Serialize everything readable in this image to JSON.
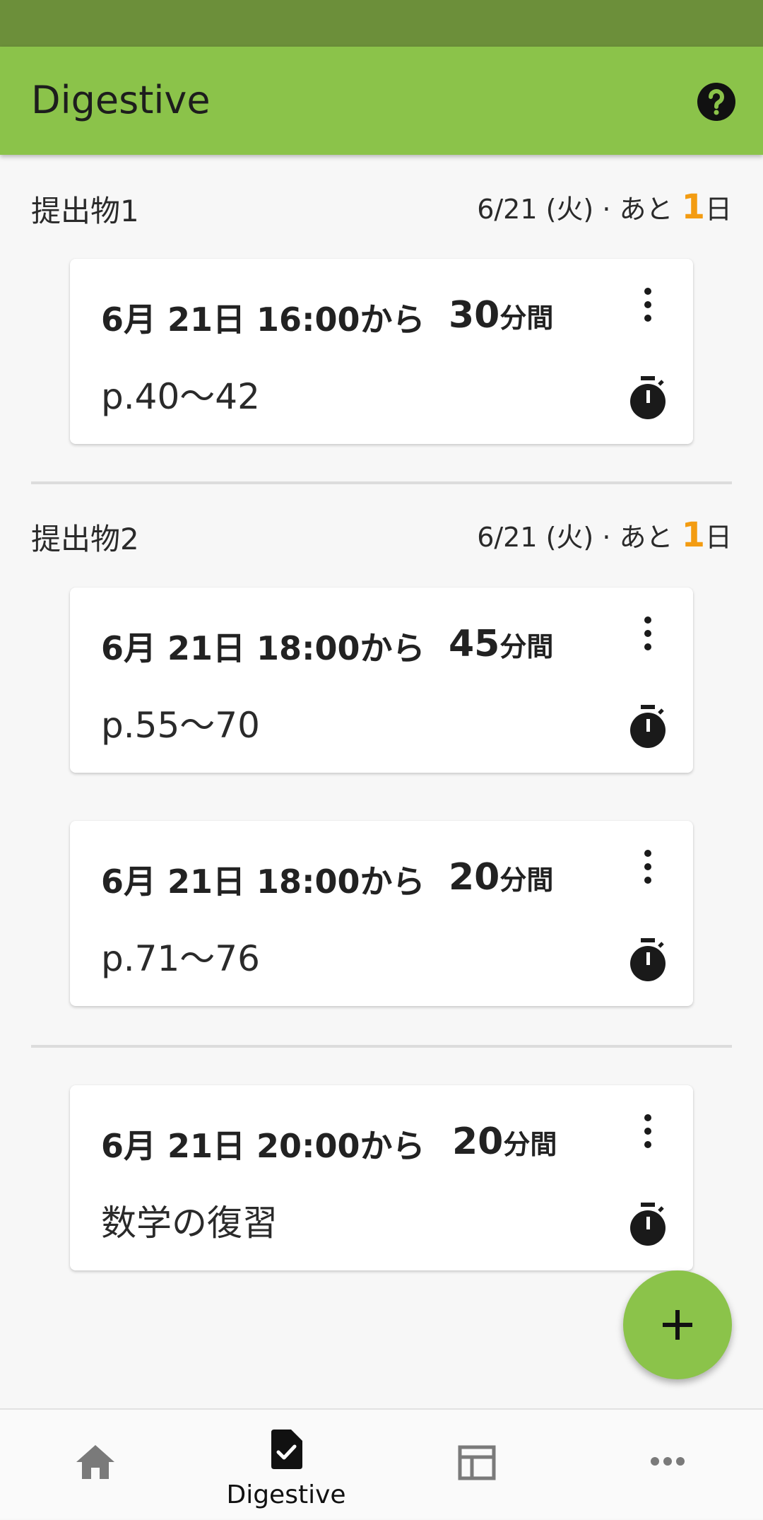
{
  "app": {
    "title": "Digestive"
  },
  "colors": {
    "accent": "#8bc34a",
    "status_bar": "#6c8f3a",
    "due_highlight": "#f39c12"
  },
  "sections": [
    {
      "title": "提出物1",
      "due_prefix": "6/21 (火) · あと ",
      "due_count": "1",
      "due_suffix": "日",
      "cards": [
        {
          "time": "6月 21日  16:00から",
          "duration_num": "30",
          "duration_unit": "分間",
          "desc": "p.40〜42"
        }
      ]
    },
    {
      "title": "提出物2",
      "due_prefix": "6/21 (火) · あと ",
      "due_count": "1",
      "due_suffix": "日",
      "cards": [
        {
          "time": "6月 21日  18:00から",
          "duration_num": "45",
          "duration_unit": "分間",
          "desc": "p.55〜70"
        },
        {
          "time": "6月 21日  18:00から",
          "duration_num": "20",
          "duration_unit": "分間",
          "desc": "p.71〜76"
        }
      ]
    },
    {
      "cards": [
        {
          "time": "6月 21日  20:00から",
          "duration_num": "20",
          "duration_unit": "分間",
          "desc": "数学の復習"
        }
      ]
    }
  ],
  "bottom_nav": [
    {
      "icon": "home-icon",
      "label": ""
    },
    {
      "icon": "assignment-check-icon",
      "label": "Digestive"
    },
    {
      "icon": "table-icon",
      "label": ""
    },
    {
      "icon": "more-horiz-icon",
      "label": ""
    }
  ]
}
